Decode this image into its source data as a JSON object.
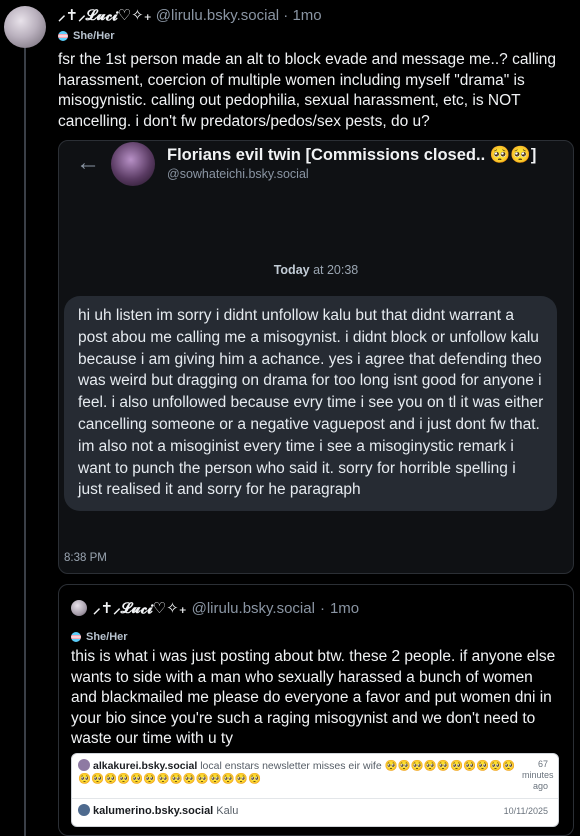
{
  "post": {
    "display_name": "⸝✝⸝𝓛𝓾𝓬𝓲♡✧₊",
    "handle": "@lirulu.bsky.social",
    "separator": "·",
    "time": "1mo",
    "pronouns": "She/Her",
    "text": "fsr the 1st person made an alt to block evade and message me..? calling harassment, coercion of multiple women including myself \"drama\" is misogynistic. calling out pedophilia, sexual harassment, etc, is NOT cancelling. i don't fw predators/pedos/sex pests, do u?"
  },
  "screenshot": {
    "back_icon": "←",
    "dm_name": "Florians evil twin [Commissions closed.. 🥺🥺]",
    "dm_handle": "@sowhateichi.bsky.social",
    "date_day": "Today",
    "date_time": " at 20:38",
    "message": "hi uh listen im sorry i didnt unfollow kalu but that didnt warrant a post abou me calling me a misogynist. i didnt block or unfollow kalu because i am giving him a achance. yes i agree that defending theo was weird but dragging on drama for too long isnt good for anyone i feel. i also unfollowed because evry time i see you on tl it was either cancelling someone or a negative vaguepost and i just dont fw that. im also not a misoginist every time i see a misoginystic remark i want to punch the person who said it. sorry for horrible spelling i just realised it and sorry for he paragraph",
    "message_time": "8:38 PM"
  },
  "quote": {
    "display_name": "⸝✝⸝𝓛𝓾𝓬𝓲♡✧₊",
    "handle": "@lirulu.bsky.social",
    "separator": "·",
    "time": "1mo",
    "pronouns": "She/Her",
    "text": "this is what i was just posting about btw. these 2 people. if anyone else wants to side with a man who sexually harassed a bunch of women and blackmailed me please do everyone a favor and put women dni in your bio since you're such a raging misogynist and we don't need to waste our time with u ty",
    "embed": {
      "user1": "alkakurei.bsky.social",
      "text1": " local enstars newsletter misses eir wife 🥺🥺🥺🥺🥺🥺🥺🥺🥺🥺🥺🥺🥺🥺🥺🥺🥺🥺🥺🥺🥺🥺🥺🥺",
      "meta1": "67 minutes ago",
      "user2": "kalumerino.bsky.social",
      "text2": " Kalu",
      "meta2": "10/11/2025"
    }
  },
  "colors": {
    "background": "#000000",
    "muted": "#8a95a3",
    "bubble": "#262b33"
  }
}
